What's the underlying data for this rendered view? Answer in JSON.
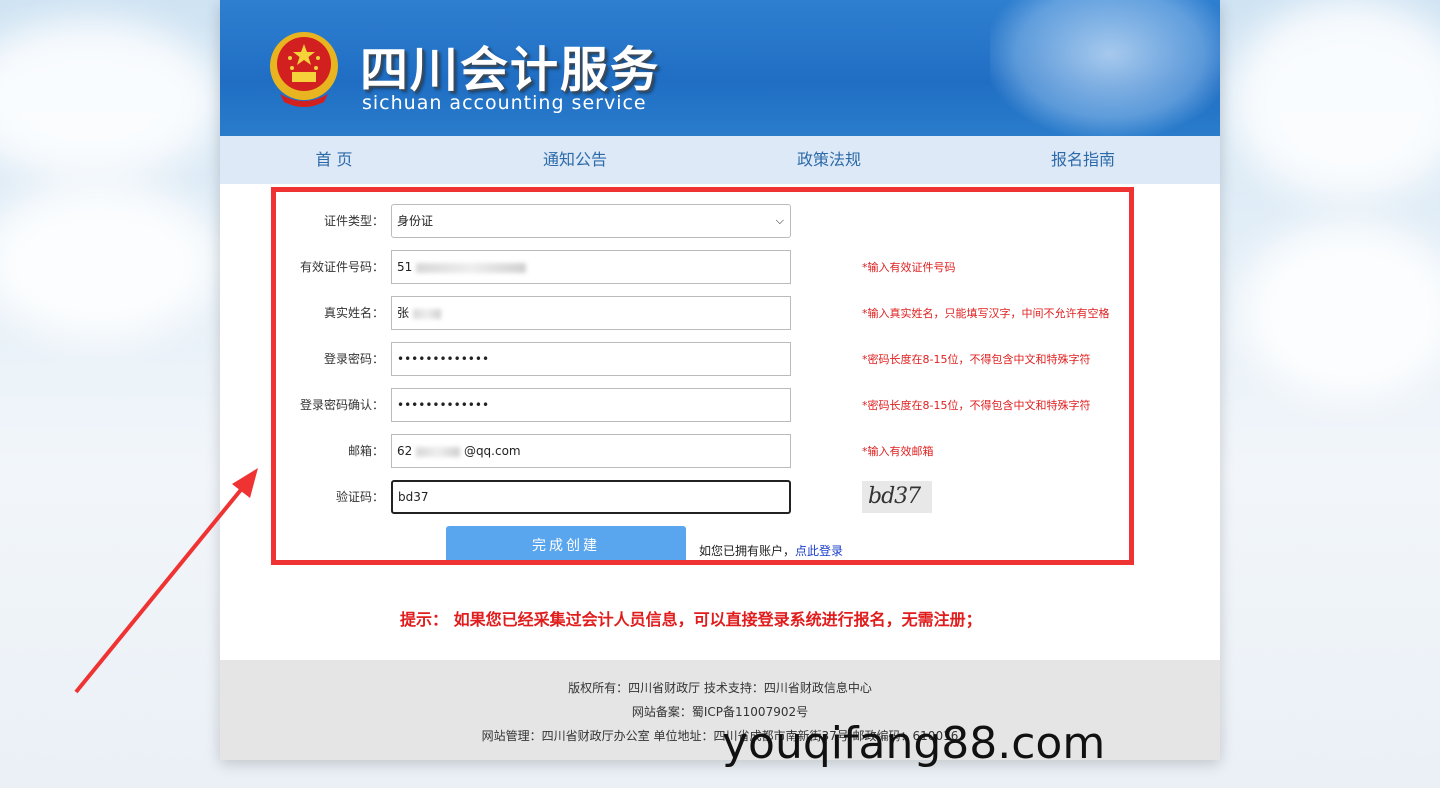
{
  "header": {
    "title": "四川会计服务",
    "subtitle": "sichuan accounting service"
  },
  "nav": {
    "items": [
      {
        "label": "首 页"
      },
      {
        "label": "通知公告"
      },
      {
        "label": "政策法规"
      },
      {
        "label": "报名指南"
      }
    ]
  },
  "form": {
    "id_type": {
      "label": "证件类型：",
      "value": "身份证"
    },
    "id_number": {
      "label": "有效证件号码：",
      "value_prefix": "51",
      "hint": "*输入有效证件号码"
    },
    "real_name": {
      "label": "真实姓名：",
      "value_prefix": "张",
      "hint": "*输入真实姓名，只能填写汉字，中间不允许有空格"
    },
    "password": {
      "label": "登录密码：",
      "value": "•••••••••••••",
      "hint": "*密码长度在8-15位，不得包含中文和特殊字符"
    },
    "password_confirm": {
      "label": "登录密码确认：",
      "value": "•••••••••••••",
      "hint": "*密码长度在8-15位，不得包含中文和特殊字符"
    },
    "email": {
      "label": "邮箱：",
      "value_prefix": "62",
      "value_suffix": "@qq.com",
      "hint": "*输入有效邮箱"
    },
    "captcha": {
      "label": "验证码：",
      "value": "bd37",
      "image_text": "bd37"
    },
    "submit_label": "完成创建",
    "login_prompt": "如您已拥有账户，",
    "login_link": "点此登录"
  },
  "tip": "提示： 如果您已经采集过会计人员信息，可以直接登录系统进行报名，无需注册；",
  "footer": {
    "line1": "版权所有：四川省财政厅 技术支持：四川省财政信息中心",
    "line2": "网站备案：蜀ICP备11007902号",
    "line3": "网站管理：四川省财政厅办公室 单位地址：四川省成都市南新街37号 邮政编码：610016"
  },
  "watermark": "youqifang88.com",
  "colors": {
    "banner": "#1f6ec4",
    "nav_bg": "#dde9f7",
    "highlight_border": "#ef3333",
    "hint_red": "#e02020",
    "button": "#5aa6ee"
  }
}
